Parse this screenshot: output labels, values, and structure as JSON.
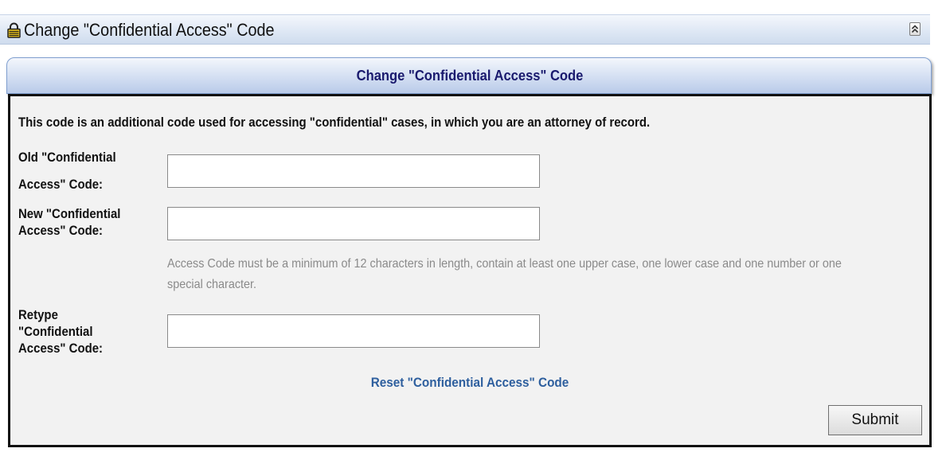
{
  "window": {
    "title": "Change \"Confidential Access\" Code",
    "icon": "lock-icon",
    "collapse_icon": "chevron-double-up-icon"
  },
  "panel": {
    "title": "Change \"Confidential Access\" Code",
    "description": "This code is an additional code used for accessing \"confidential\" cases, in which you are an attorney of record."
  },
  "form": {
    "old_code": {
      "label_line1": "Old \"Confidential",
      "label_line2": "Access\" Code:",
      "value": ""
    },
    "new_code": {
      "label_line1": "New \"Confidential",
      "label_line2": "Access\" Code:",
      "value": ""
    },
    "hint": "Access Code must be a minimum of 12 characters in length, contain at least one upper case, one lower case and one number or one special character.",
    "retype_code": {
      "label_line1": "Retype",
      "label_line2": "\"Confidential",
      "label_line3": "Access\" Code:",
      "value": ""
    },
    "reset_link": "Reset \"Confidential Access\" Code",
    "submit_label": "Submit"
  },
  "colors": {
    "panel_title": "#1a1a6e",
    "link": "#2e5f9e",
    "hint": "#8a8a8a",
    "lock": "#e8c21a"
  }
}
